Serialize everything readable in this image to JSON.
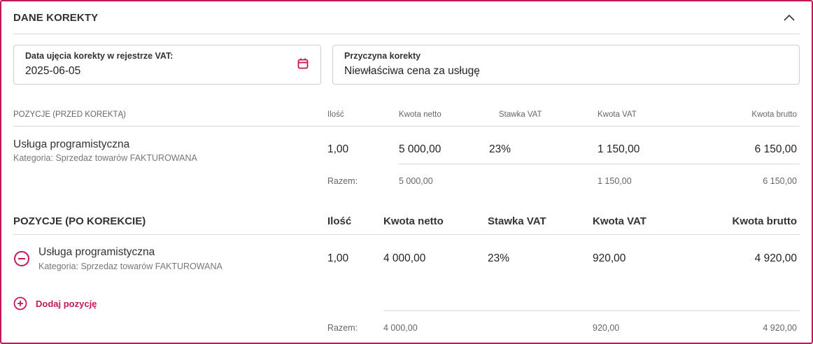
{
  "section": {
    "title": "DANE KOREKTY"
  },
  "fields": {
    "date_label": "Data ujęcia korekty w rejestrze VAT:",
    "date_value": "2025-06-05",
    "reason_label": "Przyczyna korekty",
    "reason_value": "Niewłaściwa cena za usługę"
  },
  "before": {
    "title": "POZYCJE (PRZED KOREKTĄ)",
    "headers": {
      "qty": "Ilość",
      "net": "Kwota netto",
      "rate": "Stawka VAT",
      "vat": "Kwota VAT",
      "gross": "Kwota brutto"
    },
    "item": {
      "name": "Usługa programistyczna",
      "category": "Kategoria: Sprzedaz towarów FAKTUROWANA",
      "qty": "1,00",
      "net": "5 000,00",
      "rate": "23%",
      "vat": "1 150,00",
      "gross": "6 150,00"
    },
    "totals": {
      "label": "Razem:",
      "net": "5 000,00",
      "vat": "1 150,00",
      "gross": "6 150,00"
    }
  },
  "after": {
    "title": "POZYCJE (PO KOREKCIE)",
    "headers": {
      "qty": "Ilość",
      "net": "Kwota netto",
      "rate": "Stawka VAT",
      "vat": "Kwota VAT",
      "gross": "Kwota brutto"
    },
    "item": {
      "name": "Usługa programistyczna",
      "category": "Kategoria: Sprzedaz towarów FAKTUROWANA",
      "qty": "1,00",
      "net": "4 000,00",
      "rate": "23%",
      "vat": "920,00",
      "gross": "4 920,00"
    },
    "add_label": "Dodaj pozycję",
    "totals": {
      "label": "Razem:",
      "net": "4 000,00",
      "vat": "920,00",
      "gross": "4 920,00"
    }
  },
  "colors": {
    "accent": "#c2185b",
    "border": "#d9d9d9",
    "muted": "#666666"
  },
  "icons": {
    "collapse": "chevron-up-icon",
    "calendar": "calendar-icon",
    "remove": "minus-circle-icon",
    "add": "plus-circle-icon"
  }
}
